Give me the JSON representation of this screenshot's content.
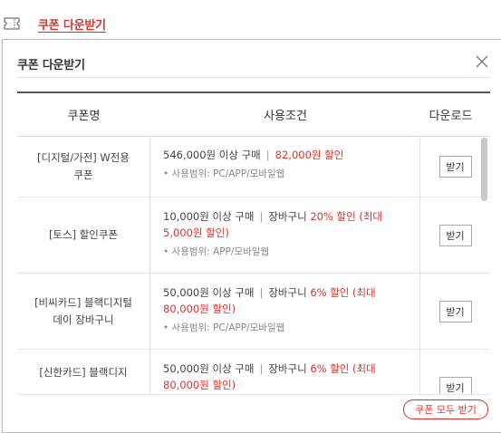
{
  "top": {
    "link_label": "쿠폰 다운받기"
  },
  "popup": {
    "title": "쿠폰 다운받기",
    "download_all_label": "쿠폰 모두 받기",
    "columns": {
      "name": "쿠폰명",
      "condition": "사용조건",
      "download": "다운로드"
    },
    "coupons": [
      {
        "name": "[디지털/가전] W전용쿠폰",
        "min_purchase": "546,000원 이상 구매",
        "separator": "|",
        "discount_prefix": "",
        "discount": "82,000원 할인",
        "scope": "• 사용범위: PC/APP/모바일웹",
        "button": "받기"
      },
      {
        "name": "[토스] 할인쿠폰",
        "min_purchase": "10,000원 이상 구매",
        "separator": "|",
        "discount_prefix": "장바구니 ",
        "discount": "20% 할인 (최대 5,000원 할인)",
        "scope": "• 사용범위: APP/모바일웹",
        "button": "받기"
      },
      {
        "name": "[비씨카드] 블랙디지털데이 장바구니",
        "min_purchase": "50,000원 이상 구매",
        "separator": "|",
        "discount_prefix": "장바구니 ",
        "discount": "6% 할인 (최대 80,000원 할인)",
        "scope": "• 사용범위: PC/APP/모바일웹",
        "button": "받기"
      },
      {
        "name": "[신한카드] 블랙디지",
        "min_purchase": "50,000원 이상 구매",
        "separator": "|",
        "discount_prefix": "장바구니 ",
        "discount": "6% 할인 (최대 80,000원 할인)",
        "scope": "",
        "button": "받기"
      }
    ]
  },
  "colors": {
    "accent": "#d8342b",
    "text": "#333333",
    "muted": "#888888",
    "border": "#e5e5e5"
  }
}
